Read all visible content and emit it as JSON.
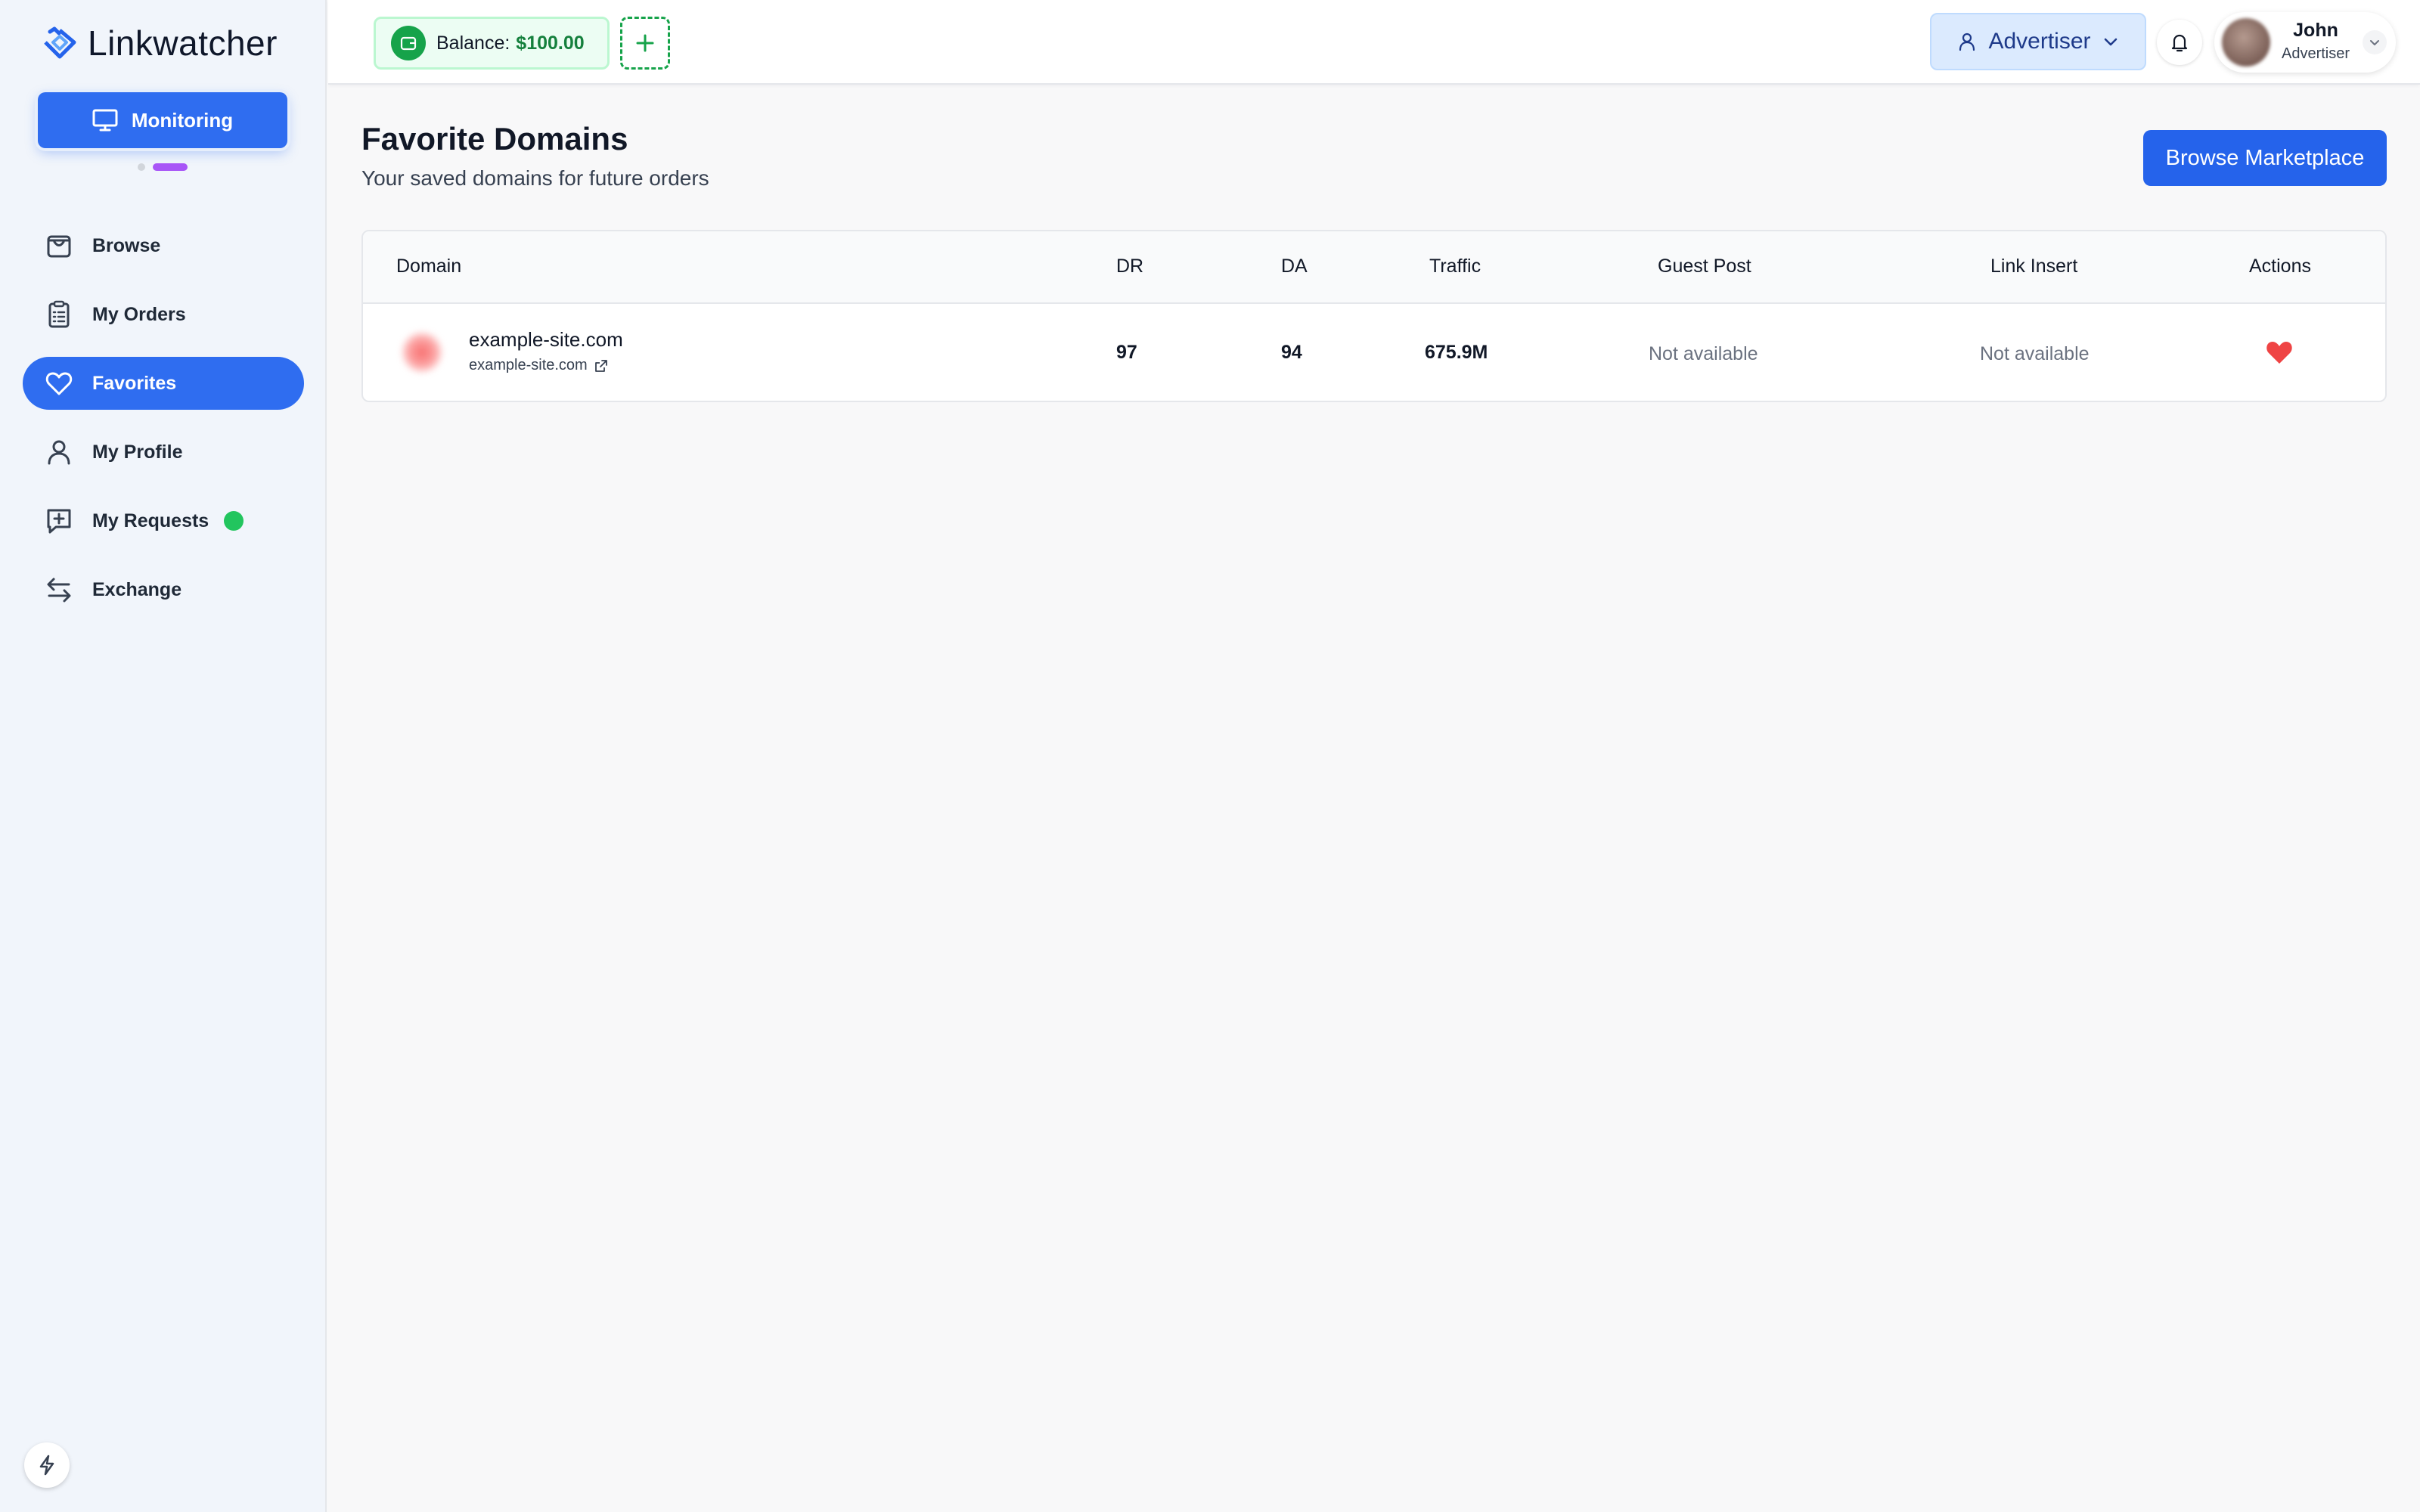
{
  "app": {
    "name": "Linkwatcher"
  },
  "sidebar": {
    "monitor_label": "Monitoring",
    "items": [
      {
        "label": "Browse",
        "icon": "shopping-bag-icon"
      },
      {
        "label": "My Orders",
        "icon": "clipboard-list-icon"
      },
      {
        "label": "Favorites",
        "icon": "heart-icon",
        "active": true
      },
      {
        "label": "My Profile",
        "icon": "user-icon"
      },
      {
        "label": "My Requests",
        "icon": "message-plus-icon",
        "badge": "green-dot"
      },
      {
        "label": "Exchange",
        "icon": "arrows-exchange-icon"
      }
    ]
  },
  "header": {
    "balance_label": "Balance:",
    "balance_value": "$100.00",
    "role": "Advertiser",
    "user": {
      "name": "John",
      "role": "Advertiser"
    }
  },
  "page": {
    "title": "Favorite Domains",
    "subtitle": "Your saved domains for future orders",
    "browse_button": "Browse Marketplace"
  },
  "table": {
    "columns": [
      "Domain",
      "DR",
      "DA",
      "Traffic",
      "Guest Post",
      "Link Insert",
      "Actions"
    ],
    "rows": [
      {
        "domain": "example-site.com",
        "url": "example-site.com",
        "dr": "97",
        "da": "94",
        "traffic": "675.9M",
        "guest_post": "Not available",
        "link_insert": "Not available"
      }
    ]
  },
  "colors": {
    "primary": "#2f6df0",
    "balance_green": "#16a34a",
    "status_green": "#22c55e",
    "heart_red": "#ef4444",
    "indicator_purple": "#a855f7"
  }
}
